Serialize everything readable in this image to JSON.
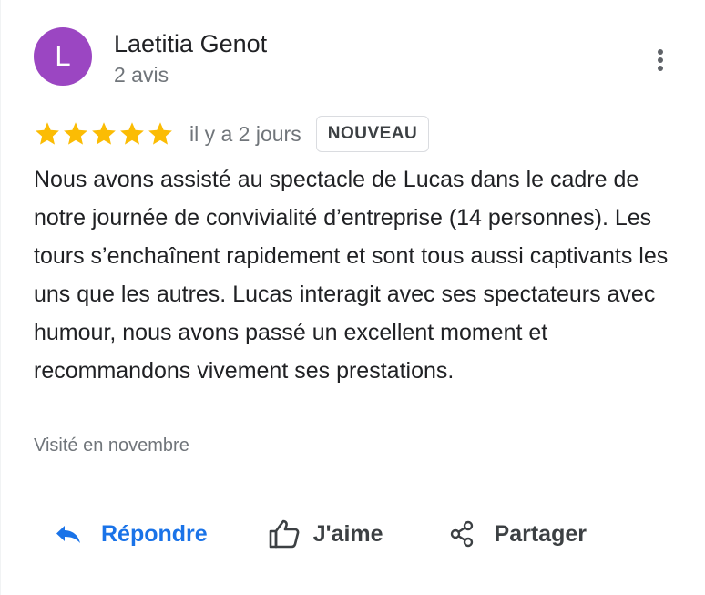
{
  "review": {
    "author": {
      "initial": "L",
      "name": "Laetitia Genot",
      "meta": "2 avis",
      "avatar_color": "#9b46c2"
    },
    "rating": 5,
    "max_rating": 5,
    "star_color": "#fbbc04",
    "time": "il y a 2 jours",
    "badge": "NOUVEAU",
    "text": "Nous avons assisté au spectacle de Lucas dans le cadre de notre journée de convivialité d’entreprise (14 personnes). Les tours s’enchaînent rapidement et sont tous aussi captivants les uns que les autres. Lucas interagit avec ses spectateurs avec humour, nous avons passé un excellent moment et recommandons vivement ses prestations.",
    "visited": "Visité en novembre"
  },
  "menu": {
    "icon": "more-vert-icon"
  },
  "actions": {
    "reply": {
      "label": "Répondre",
      "icon": "reply-icon",
      "color": "#1a73e8"
    },
    "like": {
      "label": "J'aime",
      "icon": "thumb-up-icon"
    },
    "share": {
      "label": "Partager",
      "icon": "share-icon"
    }
  }
}
